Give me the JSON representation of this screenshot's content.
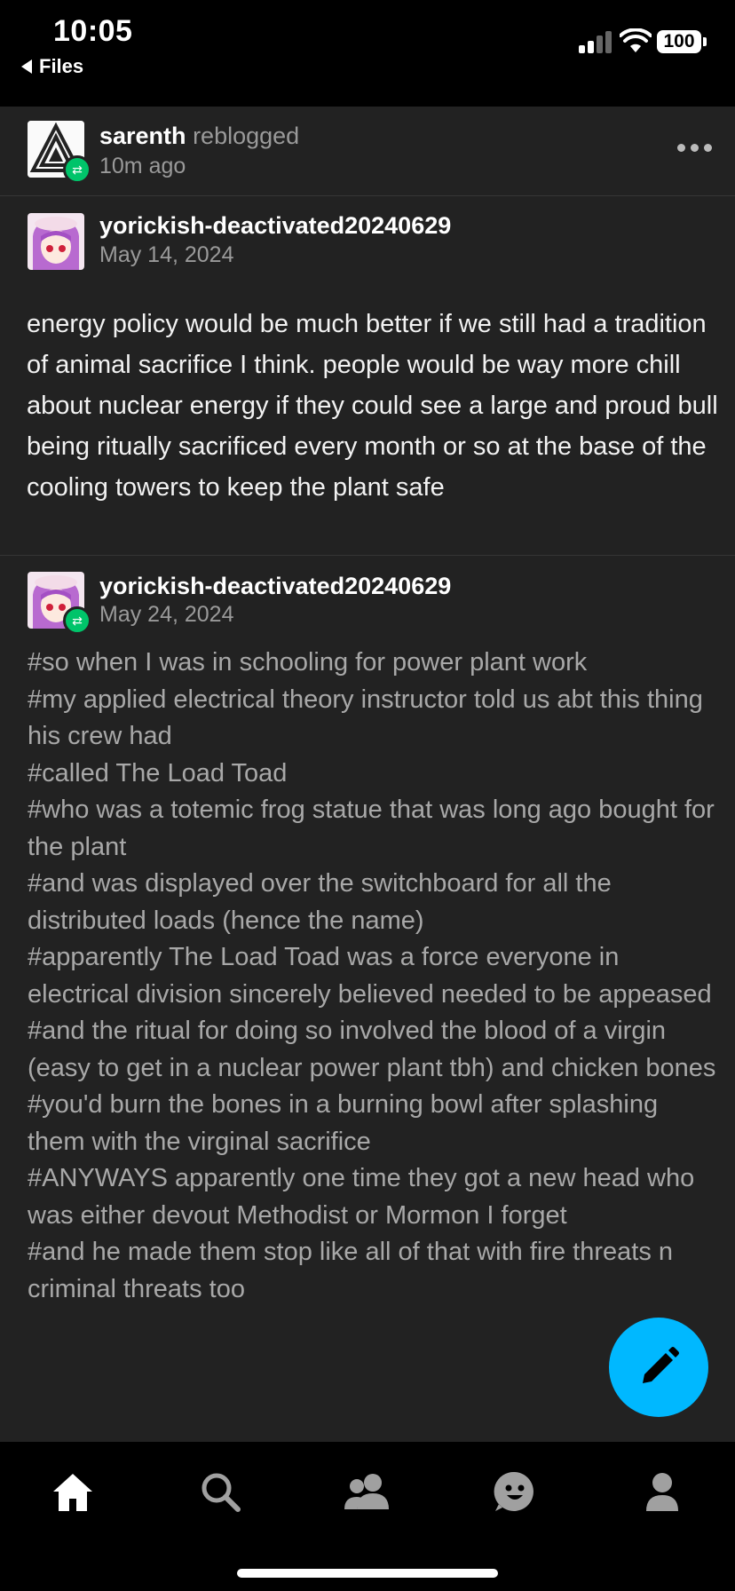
{
  "status": {
    "time": "10:05",
    "back_label": "Files",
    "battery": "100"
  },
  "post": {
    "reblogger": "sarenth",
    "reblog_verb": "reblogged",
    "reblog_time": "10m ago",
    "original": {
      "author": "yorickish-deactivated20240629",
      "date": "May 14, 2024",
      "text": "energy policy would be much better if we still had a tradition of animal sacrifice I think. people would be way more chill about nuclear energy if they could see a large and proud bull being ritually sacrificed every month or so at the base of the cooling towers to keep the plant safe"
    },
    "reblog": {
      "author": "yorickish-deactivated20240629",
      "date": "May 24, 2024",
      "tags": [
        "#so when I was in schooling for power plant work",
        "#my applied electrical theory instructor told us abt this thing his crew had",
        "#called The Load Toad",
        "#who was a totemic frog statue that was long ago bought for the plant",
        "#and was displayed over the switchboard for all the distributed loads (hence the name)",
        "#apparently The Load Toad was a force everyone in electrical division sincerely believed needed to be appeased",
        "#and the ritual for doing so involved the blood of a virgin (easy to get in a nuclear power plant tbh) and chicken bones",
        "#you'd burn the bones in a burning bowl after splashing them with the virginal sacrifice",
        "#ANYWAYS apparently one time they got a new head who was either devout Methodist or Mormon I forget",
        "#and he made them stop like all of that with fire threats n criminal threats too"
      ]
    }
  },
  "icons": {
    "more": "more-dots-icon",
    "compose": "pencil-icon",
    "tabs": [
      "home-icon",
      "search-icon",
      "people-icon",
      "smiley-icon",
      "profile-icon"
    ]
  },
  "colors": {
    "accent": "#00b8ff",
    "reblog_badge": "#00c46a",
    "background": "#222222"
  }
}
